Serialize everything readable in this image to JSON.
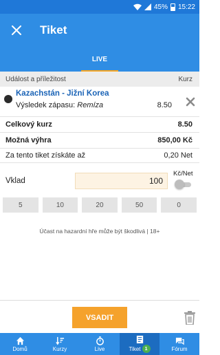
{
  "status_bar": {
    "battery": "45%",
    "time": "15:22"
  },
  "app_bar": {
    "title": "Tiket"
  },
  "tabs": [
    {
      "label": "LIVE"
    }
  ],
  "column_header": {
    "left": "Událost a příležitost",
    "right": "Kurz"
  },
  "event": {
    "name": "Kazachstán - Jižní Korea",
    "market": "Výsledek zápasu:",
    "selection": "Remíza",
    "odds": "8.50"
  },
  "summary": {
    "total_odds_label": "Celkový kurz",
    "total_odds_value": "8.50",
    "possible_win_label": "Možná výhra",
    "possible_win_value": "850,00 Kč",
    "earn_label": "Za tento tiket získáte až",
    "earn_value": "0,20 Net"
  },
  "stake": {
    "label": "Vklad",
    "value": "100",
    "toggle_label": "Kč/Net"
  },
  "quick_amounts": [
    "5",
    "10",
    "20",
    "50",
    "0"
  ],
  "notice": "Účast na hazardní hře může být škodlivá | 18+",
  "actions": {
    "submit": "VSADIT"
  },
  "bottom_nav": [
    {
      "label": "Domů",
      "icon": "home-icon"
    },
    {
      "label": "Kurzy",
      "icon": "sort-icon"
    },
    {
      "label": "Live",
      "icon": "stopwatch-icon"
    },
    {
      "label": "Tiket",
      "icon": "ticket-icon",
      "badge": "1",
      "active": true
    },
    {
      "label": "Fórum",
      "icon": "forum-icon"
    }
  ]
}
